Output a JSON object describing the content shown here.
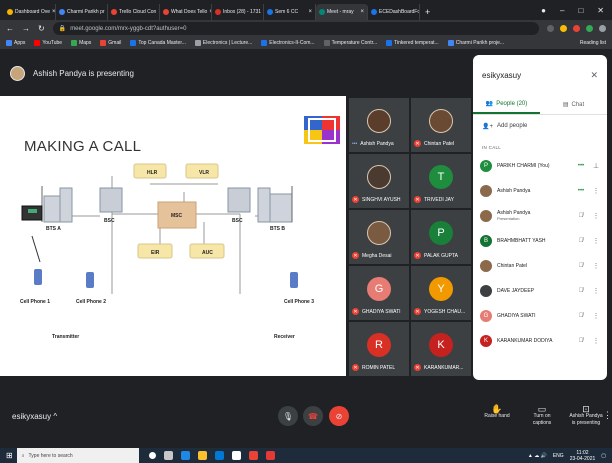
{
  "tabs": [
    {
      "label": "Dashboard Ove",
      "color": "#f4b400",
      "active": false
    },
    {
      "label": "Charmi Parikh pr",
      "color": "#4285f4",
      "active": false
    },
    {
      "label": "Trello Cloud Con",
      "color": "#ea4335",
      "active": false
    },
    {
      "label": "What Does Tello",
      "color": "#ea4335",
      "active": false
    },
    {
      "label": "Inbox (28) - 1731",
      "color": "#d93025",
      "active": false
    },
    {
      "label": "Sem 6 CC",
      "color": "#1a73e8",
      "active": false
    },
    {
      "label": "Meet - mray",
      "color": "#00897b",
      "active": true
    },
    {
      "label": "ECEDashBoardFo",
      "color": "#1a73e8",
      "active": false
    }
  ],
  "url": "meet.google.com/mrx-yggb-cdt?authuser=0",
  "bookmarks": [
    {
      "label": "Apps",
      "color": "#4285f4"
    },
    {
      "label": "YouTube",
      "color": "#ff0000"
    },
    {
      "label": "Maps",
      "color": "#34a853"
    },
    {
      "label": "Gmail",
      "color": "#ea4335"
    },
    {
      "label": "Top Canada Master...",
      "color": "#1a73e8"
    },
    {
      "label": "Electronics | Lecture...",
      "color": "#9aa0a6"
    },
    {
      "label": "Electronics-II-Com...",
      "color": "#1a73e8"
    },
    {
      "label": "Temperature Contr...",
      "color": "#5f6368"
    },
    {
      "label": "Tinkered temperat...",
      "color": "#1a73e8"
    },
    {
      "label": "Charmi Parikh proje...",
      "color": "#4285f4"
    }
  ],
  "reading_list": "Reading list",
  "presenter_banner": "Ashish Pandya is presenting",
  "slide": {
    "title": "MAKING A CALL",
    "labels": {
      "hlr": "HLR",
      "vlr": "VLR",
      "msc": "MSC",
      "eir": "EIR",
      "auc": "AUC",
      "bsc_left": "BSC",
      "bsc_right": "BSC",
      "bts_a": "BTS A",
      "bts_b": "BTS B",
      "phone1": "Cell Phone 1",
      "phone2": "Cell Phone 2",
      "phone3": "Cell Phone 3",
      "transmitter": "Transmitter",
      "receiver": "Receiver"
    }
  },
  "tiles": [
    {
      "name": "Ashish Pandya",
      "kind": "photo",
      "color": "#5a3d2b",
      "muted": false
    },
    {
      "name": "Chintan Patel",
      "kind": "photo",
      "color": "#6b4a33",
      "muted": true
    },
    {
      "name": "SINGHVI AYUSH",
      "kind": "photo",
      "color": "#4a3a30",
      "muted": true
    },
    {
      "name": "TRIVEDI JAY",
      "kind": "letter",
      "letter": "T",
      "color": "#1e8e3e",
      "muted": true
    },
    {
      "name": "Megha Desai",
      "kind": "photo",
      "color": "#7a5a40",
      "muted": true
    },
    {
      "name": "PALAK GUPTA",
      "kind": "letter",
      "letter": "P",
      "color": "#188038",
      "muted": true
    },
    {
      "name": "GHADIYA SWATI",
      "kind": "letter",
      "letter": "G",
      "color": "#e67c73",
      "muted": true
    },
    {
      "name": "YOGESH CHAU...",
      "kind": "letter",
      "letter": "Y",
      "color": "#f29900",
      "muted": true
    },
    {
      "name": "ROMIN PATEL",
      "kind": "letter",
      "letter": "R",
      "color": "#d93025",
      "muted": true
    },
    {
      "name": "KARANKUMAR...",
      "kind": "letter",
      "letter": "K",
      "color": "#c5221f",
      "muted": true
    }
  ],
  "panel": {
    "meeting_code": "esikyxasuy",
    "people_tab": "People (20)",
    "chat_tab": "Chat",
    "add_people": "Add people",
    "in_call": "IN CALL",
    "people": [
      {
        "name": "PARIKH CHARMI (You)",
        "sub": "",
        "avatar": "P",
        "color": "#1e8e3e",
        "state": "talk"
      },
      {
        "name": "Ashish Pandya",
        "sub": "",
        "avatar": "",
        "color": "#8a6a4a",
        "state": "talk"
      },
      {
        "name": "Ashish Pandya",
        "sub": "Presentation",
        "avatar": "",
        "color": "#8a6a4a",
        "state": "muted"
      },
      {
        "name": "BRAHMBHATT YASH",
        "sub": "",
        "avatar": "B",
        "color": "#137333",
        "state": "muted"
      },
      {
        "name": "Chintan Patel",
        "sub": "",
        "avatar": "",
        "color": "#8a6a4a",
        "state": "muted"
      },
      {
        "name": "DAVE JAYDEEP",
        "sub": "",
        "avatar": "",
        "color": "#3c4043",
        "state": "muted"
      },
      {
        "name": "GHADIYA SWATI",
        "sub": "",
        "avatar": "G",
        "color": "#e67c73",
        "state": "muted"
      },
      {
        "name": "KARANKUMAR DODIYA",
        "sub": "",
        "avatar": "K",
        "color": "#c5221f",
        "state": "muted"
      }
    ]
  },
  "bottom": {
    "meeting_code": "esikyxasuy",
    "raise_hand": "Raise hand",
    "captions": "Turn on captions",
    "presenting_l1": "Ashish Pandya",
    "presenting_l2": "is presenting"
  },
  "taskbar": {
    "search": "Type here to search",
    "lang": "ENG",
    "time": "11:02",
    "date": "23-04-2021"
  }
}
